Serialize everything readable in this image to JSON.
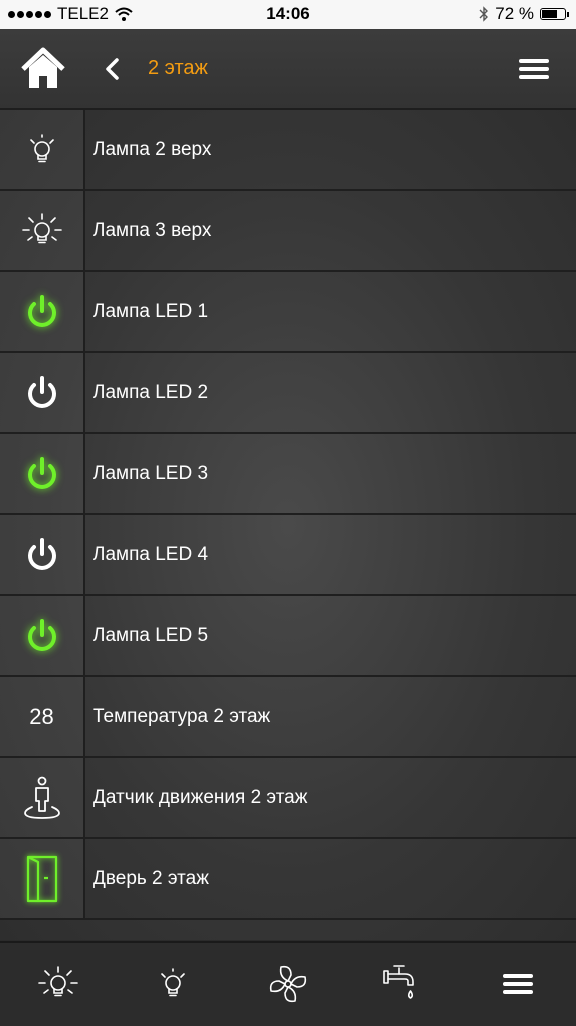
{
  "status_bar": {
    "carrier": "TELE2",
    "time": "14:06",
    "battery": "72 %",
    "battery_level": 0.72
  },
  "nav": {
    "title": "2 этаж",
    "title_color": "#f39c12"
  },
  "devices": [
    {
      "label": "Лампа 2 верх",
      "icon": "bulb-off-icon"
    },
    {
      "label": "Лампа 3 верх",
      "icon": "bulb-on-icon"
    },
    {
      "label": "Лампа LED 1",
      "icon": "power-on-icon"
    },
    {
      "label": "Лампа LED 2",
      "icon": "power-off-icon"
    },
    {
      "label": "Лампа LED 3",
      "icon": "power-on-icon"
    },
    {
      "label": "Лампа LED 4",
      "icon": "power-off-icon"
    },
    {
      "label": "Лампа LED 5",
      "icon": "power-on-icon"
    },
    {
      "label": "Температура 2 этаж",
      "icon": "temperature-value",
      "value": "28"
    },
    {
      "label": "Датчик движения 2 этаж",
      "icon": "motion-sensor-icon"
    },
    {
      "label": "Дверь 2 этаж",
      "icon": "door-icon"
    }
  ],
  "colors": {
    "active_green": "#6ff02a",
    "accent_orange": "#f39c12"
  },
  "tabs": [
    {
      "icon": "bulb-on-icon"
    },
    {
      "icon": "bulb-off-icon"
    },
    {
      "icon": "fan-icon"
    },
    {
      "icon": "water-tap-icon"
    },
    {
      "icon": "menu-icon"
    }
  ]
}
